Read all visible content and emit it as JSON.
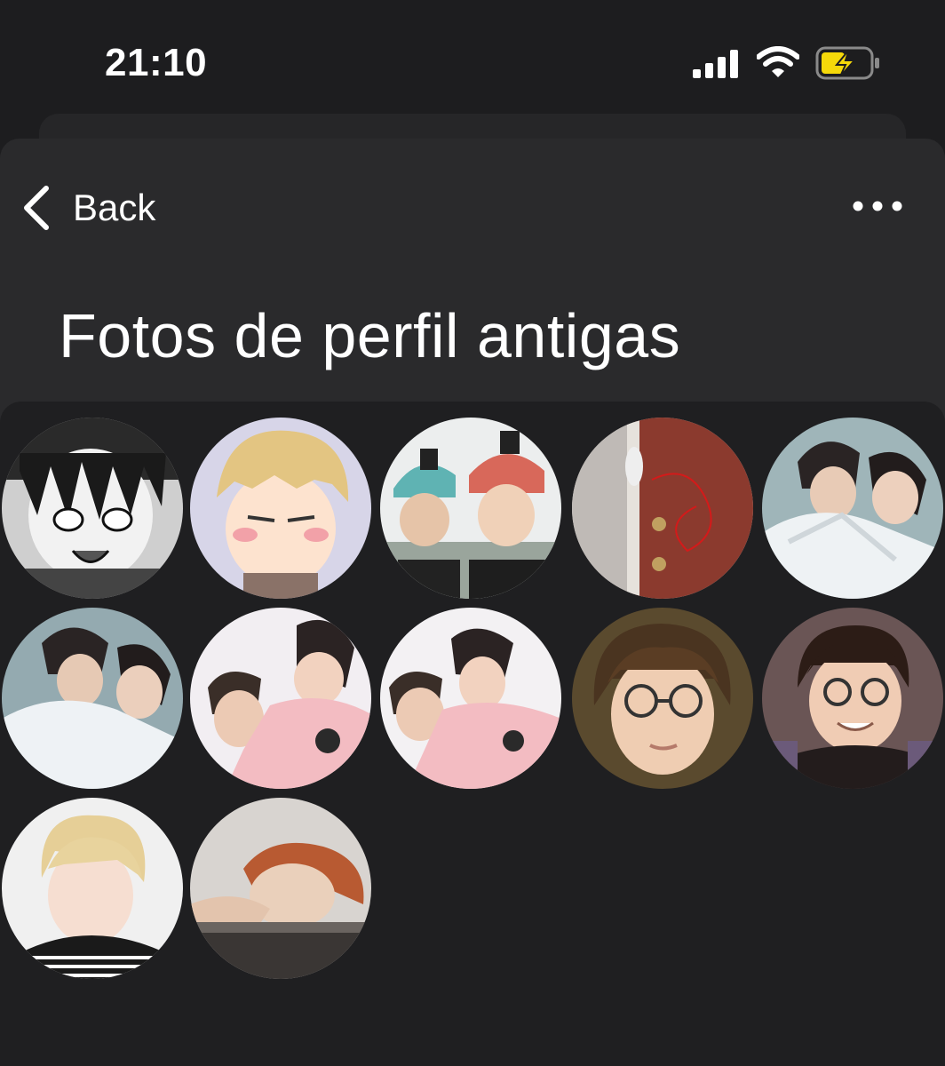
{
  "status_bar": {
    "time": "21:10",
    "signal_icon": "cellular-signal-icon",
    "wifi_icon": "wifi-icon",
    "battery_icon": "battery-charging-icon",
    "battery_color": "#f5d90a"
  },
  "nav": {
    "back_label": "Back",
    "back_icon": "chevron-left-icon",
    "more_icon": "more-horizontal-icon"
  },
  "title": "Fotos de perfil antigas",
  "photos": [
    {
      "index": 1,
      "depicts": "manga character"
    },
    {
      "index": 2,
      "depicts": "anime character"
    },
    {
      "index": 3,
      "depicts": "two people in helmets"
    },
    {
      "index": 4,
      "depicts": "red door"
    },
    {
      "index": 5,
      "depicts": "two people"
    },
    {
      "index": 6,
      "depicts": "two people"
    },
    {
      "index": 7,
      "depicts": "two people"
    },
    {
      "index": 8,
      "depicts": "two people"
    },
    {
      "index": 9,
      "depicts": "person with glasses"
    },
    {
      "index": 10,
      "depicts": "person with glasses"
    },
    {
      "index": 11,
      "depicts": "blond person"
    },
    {
      "index": 12,
      "depicts": "red-haired person"
    }
  ],
  "colors": {
    "background": "#1d1d1f",
    "sheet": "#2a2a2c",
    "grid_panel": "#1f1f21",
    "text": "#ffffff"
  }
}
